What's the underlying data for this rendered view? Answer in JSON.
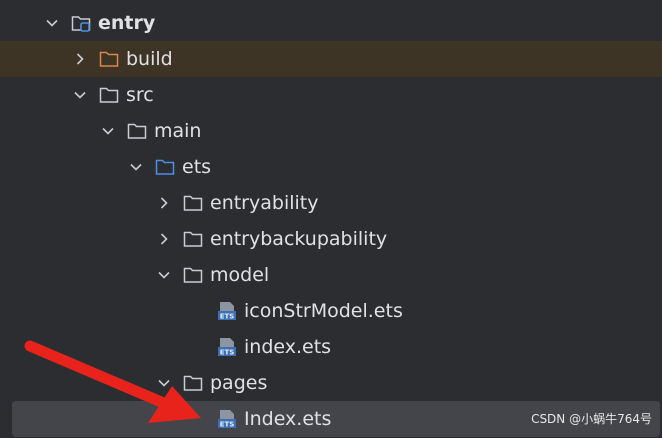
{
  "tree": {
    "items": [
      {
        "label": "entry",
        "icon": "module-folder-icon",
        "expanded": true
      },
      {
        "label": "build",
        "icon": "folder-icon",
        "expanded": false,
        "color": "#d9884a"
      },
      {
        "label": "src",
        "icon": "folder-icon",
        "expanded": true
      },
      {
        "label": "main",
        "icon": "folder-icon",
        "expanded": true
      },
      {
        "label": "ets",
        "icon": "source-folder-icon",
        "expanded": true,
        "color": "#4e8fe8"
      },
      {
        "label": "entryability",
        "icon": "folder-icon",
        "expanded": false
      },
      {
        "label": "entrybackupability",
        "icon": "folder-icon",
        "expanded": false
      },
      {
        "label": "model",
        "icon": "folder-icon",
        "expanded": true
      },
      {
        "label": "iconStrModel.ets",
        "icon": "ets-file-icon"
      },
      {
        "label": "index.ets",
        "icon": "ets-file-icon"
      },
      {
        "label": "pages",
        "icon": "folder-icon",
        "expanded": true
      },
      {
        "label": "Index.ets",
        "icon": "ets-file-icon",
        "selected": true
      }
    ]
  },
  "annotation": {
    "icon": "red-arrow-icon",
    "color": "#e8231c"
  },
  "watermark": "CSDN @小蜗牛764号",
  "colors": {
    "background": "#2b2d30",
    "selection": "#43454a",
    "highlight_row": "#3d3426",
    "text": "#dfe1e5"
  }
}
